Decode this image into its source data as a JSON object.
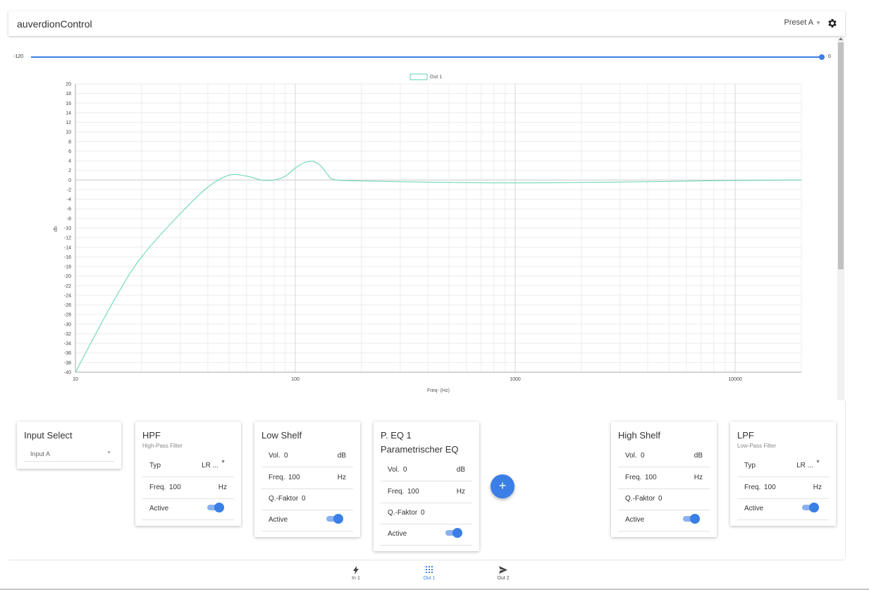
{
  "header": {
    "title": "auverdionControl",
    "preset": "Preset A",
    "gear_icon": "gear-icon"
  },
  "range_slider": {
    "min_label": "-120",
    "max_label": "0",
    "min": -120,
    "max": 0,
    "value": 0
  },
  "chart_data": {
    "type": "line",
    "title": "",
    "legend": [
      "Out 1"
    ],
    "legend_placement": "top-center",
    "xlabel": "Freq- (Hz)",
    "ylabel": "db",
    "xscale": "log",
    "xlim": [
      10,
      20000
    ],
    "ylim": [
      -40,
      20
    ],
    "x_ticks": [
      "10",
      "100",
      "1000",
      "10000"
    ],
    "y_ticks": [
      "20",
      "18",
      "16",
      "14",
      "12",
      "10",
      "8",
      "6",
      "4",
      "2",
      "0",
      "-2",
      "-4",
      "-6",
      "-8",
      "-10",
      "-12",
      "-14",
      "-16",
      "-18",
      "-20",
      "-22",
      "-24",
      "-26",
      "-28",
      "-30",
      "-32",
      "-34",
      "-36",
      "-38",
      "-40"
    ],
    "grid": true,
    "series": [
      {
        "name": "Out 1",
        "color": "#5fd3b1",
        "x": [
          10,
          15,
          20,
          30,
          40,
          50,
          60,
          70,
          80,
          90,
          100,
          110,
          120,
          130,
          140,
          150,
          200,
          500,
          1000,
          2000,
          5000,
          10000,
          20000
        ],
        "y": [
          -40,
          -25,
          -16,
          -7,
          -1.5,
          1,
          0.8,
          0,
          0,
          0.8,
          2.5,
          3.6,
          3.9,
          3,
          1.2,
          0.1,
          -0.2,
          -0.5,
          -0.6,
          -0.5,
          -0.3,
          -0.1,
          0
        ]
      }
    ]
  },
  "cards": {
    "input_select": {
      "title": "Input Select",
      "value": "Input A"
    },
    "hpf": {
      "title": "HPF",
      "subtitle": "High-Pass Filter",
      "typ_label": "Typ",
      "typ_value": "LR ...",
      "freq_label": "Freq.",
      "freq_value": "100",
      "freq_unit": "Hz",
      "active_label": "Active",
      "active": true
    },
    "low_shelf": {
      "title": "Low Shelf",
      "vol_label": "Vol.",
      "vol_value": "0",
      "vol_unit": "dB",
      "freq_label": "Freq.",
      "freq_value": "100",
      "freq_unit": "Hz",
      "q_label": "Q.-Faktor",
      "q_value": "0",
      "active_label": "Active",
      "active": true
    },
    "peq1": {
      "title": "P. EQ 1",
      "title2": "Parametrischer EQ",
      "vol_label": "Vol.",
      "vol_value": "0",
      "vol_unit": "dB",
      "freq_label": "Freq.",
      "freq_value": "100",
      "freq_unit": "Hz",
      "q_label": "Q.-Faktor",
      "q_value": "0",
      "active_label": "Active",
      "active": true
    },
    "add_label": "+",
    "high_shelf": {
      "title": "High Shelf",
      "vol_label": "Vol.",
      "vol_value": "0",
      "vol_unit": "dB",
      "freq_label": "Freq.",
      "freq_value": "100",
      "freq_unit": "Hz",
      "q_label": "Q.-Faktor",
      "q_value": "0",
      "active_label": "Active",
      "active": true
    },
    "lpf": {
      "title": "LPF",
      "subtitle": "Low-Pass Filter",
      "typ_label": "Typ",
      "typ_value": "LR ...",
      "freq_label": "Freq.",
      "freq_value": "100",
      "freq_unit": "Hz",
      "active_label": "Active",
      "active": true
    }
  },
  "bottom_nav": [
    {
      "label": "In 1",
      "icon": "bolt-icon",
      "active": false
    },
    {
      "label": "Out 1",
      "icon": "grid-icon",
      "active": true
    },
    {
      "label": "Out 2",
      "icon": "send-icon",
      "active": false
    }
  ],
  "colors": {
    "accent": "#3a7ee6",
    "curve": "#5fd3b1"
  }
}
